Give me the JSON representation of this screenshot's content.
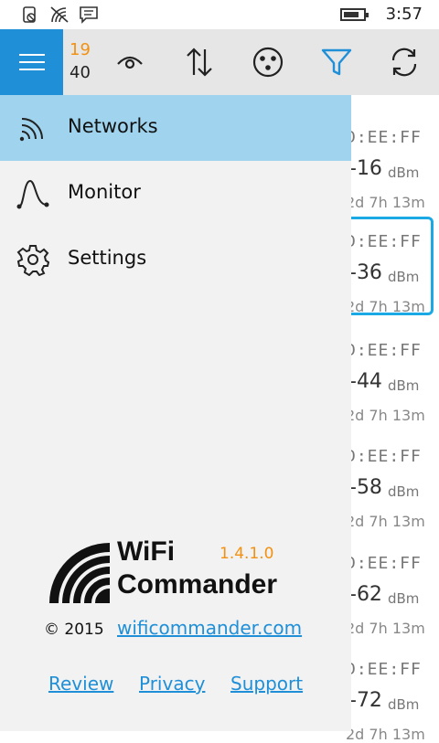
{
  "status_bar": {
    "time": "3:57",
    "icons": [
      "no-sim-icon",
      "wifi-off-icon",
      "message-icon",
      "battery-icon"
    ]
  },
  "toolbar": {
    "menu_icon": "hamburger-icon",
    "count_top": "19",
    "count_bottom": "40",
    "buttons": [
      "eye-icon",
      "sort-icon",
      "group-icon",
      "filter-icon",
      "refresh-icon"
    ],
    "accent_color": "#1f8fd8",
    "count_color": "#f29111"
  },
  "nav": {
    "items": [
      {
        "label": "Networks",
        "icon": "wifi-signal-icon",
        "active": true
      },
      {
        "label": "Monitor",
        "icon": "signal-curve-icon",
        "active": false
      },
      {
        "label": "Settings",
        "icon": "gear-icon",
        "active": false
      }
    ]
  },
  "networks": [
    {
      "mac": "D:EE:FF",
      "dbm": "-16",
      "unit": "dBm",
      "age": "2d 7h 13m",
      "selected": false
    },
    {
      "mac": "D:EE:FF",
      "dbm": "-36",
      "unit": "dBm",
      "age": "2d 7h 13m",
      "selected": true
    },
    {
      "mac": "D:EE:FF",
      "dbm": "-44",
      "unit": "dBm",
      "age": "2d 7h 13m",
      "selected": false
    },
    {
      "mac": "D:EE:FF",
      "dbm": "-58",
      "unit": "dBm",
      "age": "2d 7h 13m",
      "selected": false
    },
    {
      "mac": "D:EE:FF",
      "dbm": "-62",
      "unit": "dBm",
      "age": "2d 7h 13m",
      "selected": false
    },
    {
      "mac": "D:EE:FF",
      "dbm": "-72",
      "unit": "dBm",
      "age": "2d 7h 13m",
      "selected": false
    }
  ],
  "about": {
    "app_name_line1": "WiFi",
    "app_name_line2": "Commander",
    "version": "1.4.1.0",
    "copyright": "© 2015",
    "website": "wificommander.com",
    "links": {
      "review": "Review",
      "privacy": "Privacy",
      "support": "Support"
    }
  }
}
